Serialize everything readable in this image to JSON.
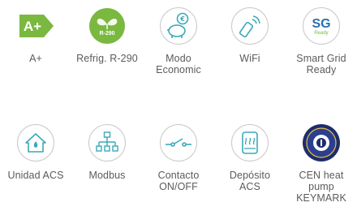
{
  "colors": {
    "green": "#7ab840",
    "teal": "#3aa9b7",
    "gray_text": "#5b5b5b",
    "sg_blue": "#2a6fb3",
    "keymark_navy": "#1e2d6b"
  },
  "features": [
    {
      "icon": "a-plus-energy-label-icon",
      "badge": "A+",
      "label": "A+"
    },
    {
      "icon": "refrigerant-leaf-icon",
      "badge": "R-290",
      "label": "Refrig. R-290"
    },
    {
      "icon": "piggy-bank-euro-icon",
      "label": "Modo\nEconomic"
    },
    {
      "icon": "wifi-remote-icon",
      "label": "WiFi"
    },
    {
      "icon": "smart-grid-ready-icon",
      "badge": "SG",
      "badge_sub": "Ready",
      "label": "Smart Grid\nReady"
    },
    {
      "icon": "house-water-drop-icon",
      "label": "Unidad ACS"
    },
    {
      "icon": "network-hierarchy-icon",
      "label": "Modbus"
    },
    {
      "icon": "switch-contact-icon",
      "label": "Contacto\nON/OFF"
    },
    {
      "icon": "water-tank-icon",
      "label": "Depósito\nACS"
    },
    {
      "icon": "keymark-seal-icon",
      "label": "CEN heat\npump\nKEYMARK"
    }
  ]
}
